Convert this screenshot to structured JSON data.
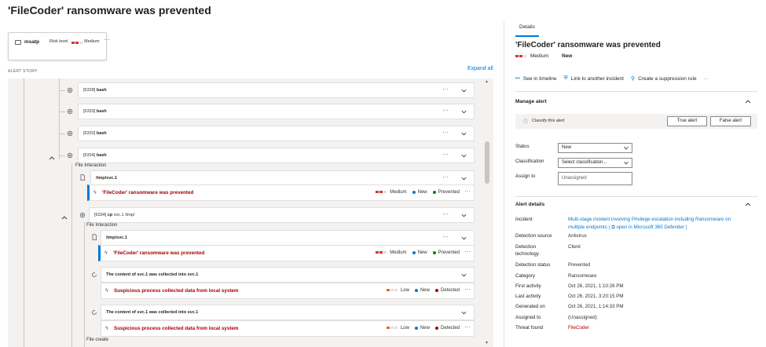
{
  "page": {
    "title": "'FileCoder' ransomware was prevented"
  },
  "device_card": {
    "name": "msatp",
    "risk_label": "Risk level",
    "risk_value": "Medium",
    "more": "···"
  },
  "story": {
    "label": "ALERT STORY",
    "expand_all": "Expand all",
    "nodes": [
      {
        "pid": "[6328]",
        "name": "bash"
      },
      {
        "pid": "[6333]",
        "name": "bash"
      },
      {
        "pid": "[6332]",
        "name": "bash"
      },
      {
        "pid": "[6334]",
        "name": "bash"
      }
    ],
    "file_interaction_1": "File Interaction",
    "file_1": "/tmp/svc.1",
    "alert_1": {
      "title": "'FileCoder' ransomware was prevented",
      "severity": "Medium",
      "status": "New",
      "determination": "Prevented"
    },
    "cp_node": {
      "pid": "[6334]",
      "cmd": "cp",
      "args": "svc.1 /tmp/"
    },
    "file_interaction_2": "File Interaction",
    "file_2": "/tmp/svc.1",
    "alert_2": {
      "title": "'FileCoder' ransomware was prevented",
      "severity": "Medium",
      "status": "New",
      "determination": "Prevented"
    },
    "collect_1": "The content of svc.1 was collected into svc.1",
    "alert_3": {
      "title": "Suspicious process collected data from local system",
      "severity": "Low",
      "status": "New",
      "determination": "Detected"
    },
    "collect_2": "The content of svc.1 was collected into svc.1",
    "alert_4": {
      "title": "Suspicious process collected data from local system",
      "severity": "Low",
      "status": "New",
      "determination": "Detected"
    },
    "file_create": "File create",
    "more": "···"
  },
  "details": {
    "tab": "Details",
    "title": "'FileCoder' ransomware was prevented",
    "severity": "Medium",
    "status": "New",
    "actions": {
      "timeline": "See in timeline",
      "link_incident": "Link to another incident",
      "suppression": "Create a suppression rule",
      "more": "···"
    },
    "manage": {
      "header": "Manage alert",
      "classify_text": "Classify this alert",
      "true_alert": "True alert",
      "false_alert": "False alert",
      "status_label": "Status",
      "status_value": "New",
      "classification_label": "Classification",
      "classification_placeholder": "Select classification...",
      "assign_label": "Assign to",
      "assign_placeholder": "Unassigned"
    },
    "alert_details": {
      "header": "Alert details",
      "incident_label": "Incident",
      "incident_value_1": "Multi-stage incident involving Privilege escalation including Ransomware on",
      "incident_value_2": "multiple endpoints ( ⧉ open in Microsoft 365 Defender )",
      "source_label": "Detection source",
      "source_value": "Antivirus",
      "tech_label_1": "Detection",
      "tech_label_2": "technology",
      "tech_value": "Client",
      "dstatus_label": "Detection status",
      "dstatus_value": "Prevented",
      "category_label": "Category",
      "category_value": "Ransomware",
      "first_label": "First activity",
      "first_value": "Oct 26, 2021, 1:10:26 PM",
      "last_label": "Last activity",
      "last_value": "Oct 26, 2021, 3:20:15 PM",
      "generated_label": "Generated on",
      "generated_value": "Oct 26, 2021, 1:14:33 PM",
      "assigned_label": "Assigned to",
      "assigned_value": "(Unassigned)",
      "threat_label": "Threat found",
      "threat_value": "FileCoder"
    }
  },
  "colors": {
    "accent": "#0078d4",
    "severity_red": "#d13438",
    "alert_red": "#a80000",
    "low_orange": "#f7630c",
    "new_blue": "#0078d4",
    "prevented_green": "#107c10",
    "detected_red": "#a80000"
  }
}
